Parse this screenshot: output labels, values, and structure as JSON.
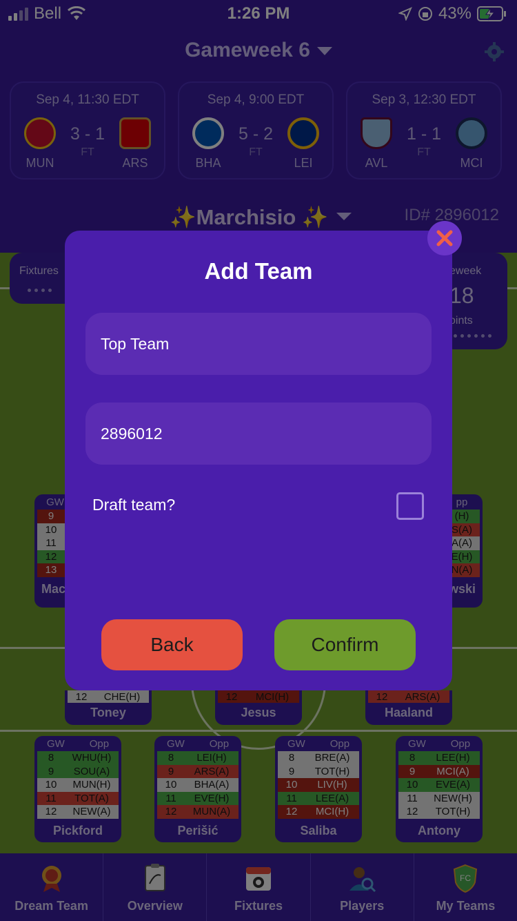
{
  "status_bar": {
    "carrier": "Bell",
    "time": "1:26 PM",
    "battery": "43%"
  },
  "header": {
    "gameweek": "Gameweek 6"
  },
  "fixtures": [
    {
      "date": "Sep 4, 11:30 EDT",
      "home": "MUN",
      "away": "ARS",
      "score": "3 - 1",
      "status": "FT",
      "home_color": "#c8102e",
      "away_color": "#db0007"
    },
    {
      "date": "Sep 4, 9:00 EDT",
      "home": "BHA",
      "away": "LEI",
      "score": "5 - 2",
      "status": "FT",
      "home_color": "#0057b8",
      "away_color": "#003090"
    },
    {
      "date": "Sep 3, 12:30 EDT",
      "home": "AVL",
      "away": "MCI",
      "score": "1 - 1",
      "status": "FT",
      "home_color": "#95bfe5",
      "away_color": "#6cabdd"
    }
  ],
  "manager": {
    "name": "✨Marchisio ✨",
    "id": "ID# 2896012"
  },
  "side_panels": {
    "left": "Fixtures",
    "right_top": "eweek",
    "right_num": "18",
    "right_sub": "oints"
  },
  "mid_cards": {
    "left": {
      "head_gw": "GW",
      "rows": [
        "9",
        "10",
        "11",
        "12",
        "13"
      ],
      "name": "Mac"
    },
    "right": {
      "head_op": "pp",
      "rows": [
        "(H)",
        "S(A)",
        "A(A)",
        "E(H)",
        "N(A)"
      ],
      "name": "wski"
    }
  },
  "mini_cards": [
    {
      "gw": "12",
      "opp": "CHE(H)",
      "name": "Toney"
    },
    {
      "gw": "12",
      "opp": "MCI(H)",
      "name": "Jesus"
    },
    {
      "gw": "12",
      "opp": "ARS(A)",
      "name": "Haaland"
    }
  ],
  "player_cards": [
    {
      "name": "Pickford",
      "head": [
        "GW",
        "Opp"
      ],
      "rows": [
        [
          "8",
          "WHU(H)"
        ],
        [
          "9",
          "SOU(A)"
        ],
        [
          "10",
          "MUN(H)"
        ],
        [
          "11",
          "TOT(A)"
        ],
        [
          "12",
          "NEW(A)"
        ]
      ]
    },
    {
      "name": "Perišić",
      "head": [
        "GW",
        "Opp"
      ],
      "rows": [
        [
          "8",
          "LEI(H)"
        ],
        [
          "9",
          "ARS(A)"
        ],
        [
          "10",
          "BHA(A)"
        ],
        [
          "11",
          "EVE(H)"
        ],
        [
          "12",
          "MUN(A)"
        ]
      ]
    },
    {
      "name": "Saliba",
      "head": [
        "GW",
        "Opp"
      ],
      "rows": [
        [
          "8",
          "BRE(A)"
        ],
        [
          "9",
          "TOT(H)"
        ],
        [
          "10",
          "LIV(H)"
        ],
        [
          "11",
          "LEE(A)"
        ],
        [
          "12",
          "MCI(H)"
        ]
      ]
    },
    {
      "name": "Antony",
      "head": [
        "GW",
        "Opp"
      ],
      "rows": [
        [
          "8",
          "LEE(H)"
        ],
        [
          "9",
          "MCI(A)"
        ],
        [
          "10",
          "EVE(A)"
        ],
        [
          "11",
          "NEW(H)"
        ],
        [
          "12",
          "TOT(H)"
        ]
      ]
    }
  ],
  "tabs": [
    {
      "label": "Dream Team",
      "icon": "medal-icon"
    },
    {
      "label": "Overview",
      "icon": "tactics-board-icon"
    },
    {
      "label": "Fixtures",
      "icon": "calendar-icon"
    },
    {
      "label": "Players",
      "icon": "player-search-icon"
    },
    {
      "label": "My Teams",
      "icon": "shield-icon"
    }
  ],
  "modal": {
    "title": "Add Team",
    "team_name_value": "Top Team",
    "team_id_value": "2896012",
    "draft_label": "Draft team?",
    "draft_checked": false,
    "back_label": "Back",
    "confirm_label": "Confirm"
  }
}
